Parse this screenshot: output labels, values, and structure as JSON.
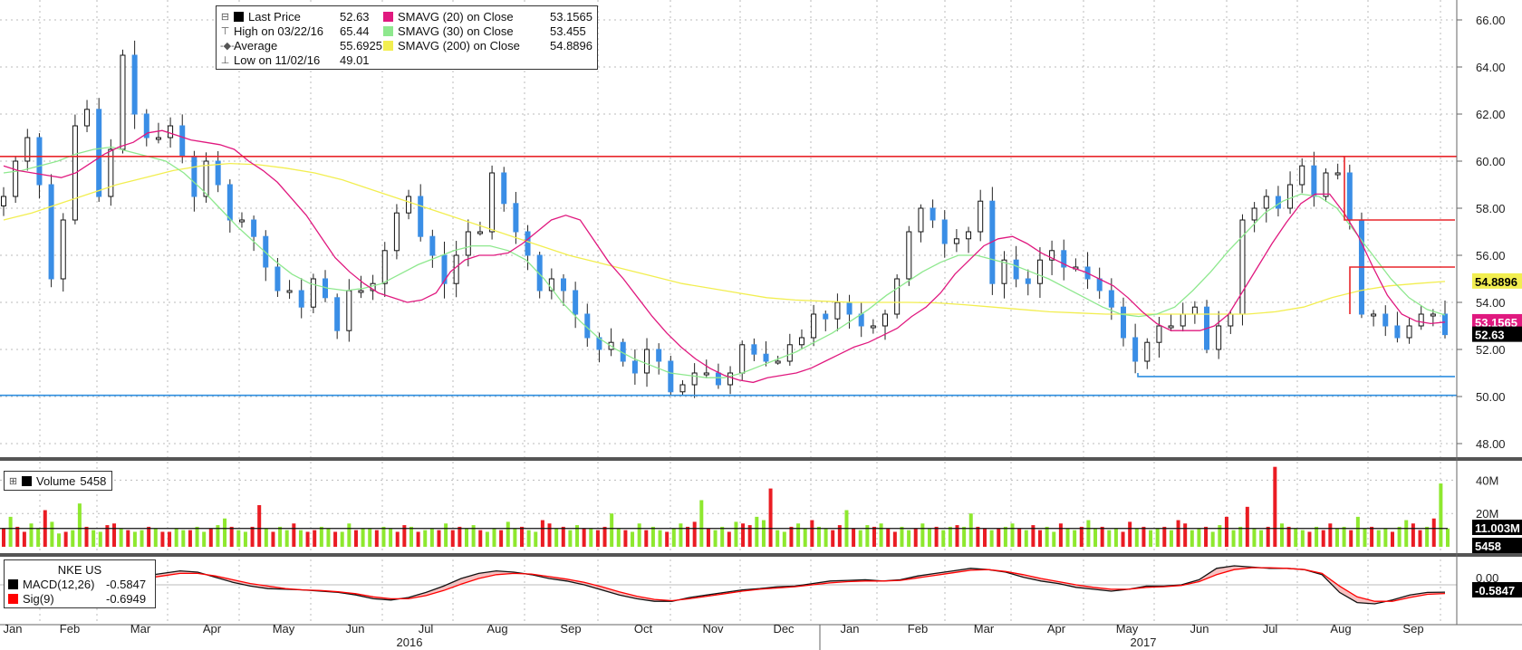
{
  "chart_data": [
    {
      "type": "candlestick",
      "ticker": "NKE US",
      "y_ticks": [
        "48.00",
        "50.00",
        "52.00",
        "54.00",
        "56.00",
        "58.00",
        "60.00",
        "62.00",
        "64.00",
        "66.00"
      ],
      "ylim": [
        47,
        67
      ],
      "x_month_labels": [
        "Jan",
        "Feb",
        "Mar",
        "Apr",
        "May",
        "Jun",
        "Jul",
        "Aug",
        "Sep",
        "Oct",
        "Nov",
        "Dec",
        "Jan",
        "Feb",
        "Mar",
        "Apr",
        "May",
        "Jun",
        "Jul",
        "Aug",
        "Sep"
      ],
      "x_year_labels": [
        "2016",
        "2017"
      ],
      "legend": [
        {
          "label": "Last Price",
          "value": "52.63",
          "color": "#000000"
        },
        {
          "label": "High on 03/22/16",
          "value": "65.44"
        },
        {
          "label": "Average",
          "value": "55.6925"
        },
        {
          "label": "Low on 11/02/16",
          "value": "49.01"
        },
        {
          "label": "SMAVG (20) on Close",
          "value": "53.1565",
          "color": "#e0197f"
        },
        {
          "label": "SMAVG (30) on Close",
          "value": "53.455",
          "color": "#8ee88e"
        },
        {
          "label": "SMAVG (200) on Close",
          "value": "54.8896",
          "color": "#f2ee50"
        }
      ],
      "close_series": [
        58.5,
        60,
        61,
        59,
        55,
        57.5,
        61.5,
        62.2,
        58.5,
        60.5,
        64.5,
        62,
        61,
        61,
        61.5,
        60.2,
        58.5,
        60,
        59,
        57.5,
        57.5,
        56.8,
        55.5,
        54.5,
        54.5,
        53.8,
        55,
        54.2,
        52.8,
        54.5,
        54.5,
        54.8,
        56.2,
        57.8,
        58.5,
        56.8,
        56,
        54.8,
        56,
        57,
        57,
        59.5,
        58.2,
        57,
        56,
        54.5,
        55,
        54.5,
        53.5,
        52.5,
        52,
        52.3,
        51.5,
        51,
        52,
        51.5,
        50.2,
        50.5,
        51,
        51,
        50.5,
        51,
        52.2,
        51.8,
        51.5,
        51.5,
        52.2,
        52.5,
        53.5,
        53.3,
        54,
        53.5,
        53,
        53,
        53.5,
        55,
        57,
        58,
        57.5,
        56.5,
        56.7,
        57,
        58.3,
        54.8,
        55.8,
        55,
        54.8,
        55.8,
        56.2,
        55.5,
        55.5,
        55,
        54.5,
        53.8,
        52.5,
        51.5,
        52.3,
        53,
        53,
        53.5,
        53.8,
        52,
        53,
        53.5,
        57.5,
        58,
        58.5,
        58,
        59,
        59.8,
        58.5,
        59.5,
        59.5,
        57.5,
        53.5,
        53.5,
        53,
        52.5,
        53,
        53.5,
        53.5,
        52.63
      ],
      "sma20": [
        59.8,
        59.6,
        59.5,
        59.4,
        59.3,
        59.5,
        59.9,
        60.3,
        60.6,
        60.8,
        61.2,
        61.3,
        61.1,
        60.9,
        60.8,
        60.7,
        60.5,
        60,
        59.6,
        59.1,
        58.4,
        57.7,
        56.8,
        55.9,
        55.3,
        54.8,
        54.4,
        54.2,
        54,
        54.1,
        54.4,
        55.3,
        55.8,
        56,
        56,
        56.1,
        56.5,
        57,
        57.5,
        57.7,
        57.5,
        56.6,
        55.7,
        55,
        54.2,
        53.4,
        52.7,
        52.1,
        51.6,
        51.2,
        50.9,
        50.7,
        50.6,
        50.8,
        50.9,
        51,
        51.2,
        51.5,
        51.8,
        52.1,
        52.3,
        52.6,
        52.9,
        53.4,
        53.8,
        54.4,
        55.2,
        55.8,
        56.4,
        56.7,
        56.8,
        56.5,
        56.1,
        55.8,
        55.5,
        55.3,
        55,
        54.7,
        54.2,
        53.6,
        53.1,
        52.8,
        52.8,
        52.8,
        53,
        53.5,
        54.5,
        55.5,
        56.5,
        57.4,
        58.2,
        58.6,
        58.6,
        57.8,
        56.8,
        55.5,
        54.3,
        53.5,
        53.2,
        53.1,
        53.16
      ],
      "sma30": [
        59.5,
        59.6,
        59.8,
        60,
        60.3,
        60.5,
        60.6,
        60.4,
        60.2,
        60,
        59.5,
        58.8,
        58,
        57.2,
        56.5,
        55.8,
        55.2,
        54.8,
        54.6,
        54.5,
        54.6,
        54.8,
        55.2,
        55.6,
        55.9,
        56.2,
        56.4,
        56.4,
        56.2,
        55.8,
        55,
        54,
        53.2,
        52.5,
        52,
        51.6,
        51.3,
        51,
        50.9,
        50.8,
        50.8,
        51,
        51.3,
        51.6,
        51.9,
        52.3,
        52.7,
        53.2,
        53.7,
        54.3,
        54.8,
        55.3,
        55.7,
        56,
        56,
        55.8,
        55.6,
        55.3,
        55,
        54.6,
        54.2,
        53.8,
        53.5,
        53.4,
        53.5,
        53.8,
        54.5,
        55.3,
        56.2,
        57,
        57.8,
        58.3,
        58.6,
        58.5,
        58,
        57,
        56,
        55,
        54.2,
        53.7,
        53.46
      ],
      "sma200": [
        57.5,
        57.8,
        58.2,
        58.6,
        59,
        59.3,
        59.6,
        59.8,
        59.9,
        59.85,
        59.7,
        59.5,
        59.2,
        58.8,
        58.4,
        58,
        57.6,
        57.2,
        56.8,
        56.4,
        56,
        55.7,
        55.4,
        55.1,
        54.8,
        54.6,
        54.4,
        54.2,
        54.1,
        54.05,
        54,
        54,
        54,
        53.98,
        53.9,
        53.8,
        53.7,
        53.6,
        53.55,
        53.5,
        53.5,
        53.5,
        53.5,
        53.5,
        53.5,
        53.6,
        53.8,
        54.2,
        54.5,
        54.7,
        54.8,
        54.89
      ],
      "resistance_levels": [
        60.2,
        57.5,
        55.5
      ],
      "support_levels": [
        50.05,
        50.85
      ],
      "axis_tags": [
        {
          "text": "54.8896",
          "value": 54.8896,
          "bg": "#f2ee50",
          "fg": "#000000"
        },
        {
          "text": "53.1565",
          "value": 53.1565,
          "bg": "#e0197f",
          "fg": "#ffffff"
        },
        {
          "text": "52.63",
          "value": 52.63,
          "bg": "#000000",
          "fg": "#ffffff"
        }
      ]
    },
    {
      "type": "bar",
      "title": "Volume",
      "value": "5458",
      "y_ticks": [
        "20M",
        "40M"
      ],
      "tags": [
        {
          "text": "11.003M",
          "bg": "#000000",
          "fg": "#ffffff"
        },
        {
          "text": "5458",
          "bg": "#000000",
          "fg": "#ffffff"
        }
      ],
      "volume_average": 11.003,
      "volume_m": [
        11,
        18,
        12,
        9,
        14,
        11,
        22,
        15,
        8,
        9,
        10,
        26,
        12,
        10,
        9,
        13,
        14,
        11,
        10,
        9,
        10,
        12,
        11,
        9,
        9,
        11,
        10,
        10,
        12,
        9,
        11,
        13,
        17,
        12,
        10,
        9,
        12,
        25,
        11,
        9,
        12,
        10,
        14,
        10,
        9,
        10,
        12,
        11,
        9,
        9,
        14,
        10,
        11,
        11,
        10,
        12,
        11,
        9,
        13,
        12,
        9,
        10,
        11,
        10,
        14,
        10,
        12,
        11,
        13,
        10,
        9,
        11,
        10,
        15,
        11,
        12,
        10,
        9,
        16,
        14,
        11,
        12,
        10,
        13,
        11,
        11,
        10,
        12,
        20,
        11,
        10,
        9,
        14,
        10,
        12,
        10,
        9,
        11,
        14,
        12,
        15,
        28,
        11,
        10,
        12,
        9,
        15,
        14,
        13,
        18,
        16,
        35,
        10,
        9,
        12,
        14,
        11,
        16,
        12,
        11,
        10,
        13,
        22,
        11,
        10,
        13,
        12,
        14,
        11,
        9,
        12,
        10,
        11,
        14,
        11,
        12,
        10,
        12,
        13,
        12,
        20,
        12,
        11,
        10,
        11,
        12,
        14,
        11,
        10,
        13,
        10,
        12,
        9,
        14,
        11,
        10,
        12,
        16,
        11,
        12,
        10,
        11,
        9,
        15,
        11,
        12,
        10,
        11,
        12,
        10,
        16,
        14,
        10,
        11,
        12,
        9,
        13,
        18,
        10,
        12,
        24,
        11,
        10,
        12,
        48,
        14,
        12,
        11,
        10,
        9,
        12,
        10,
        14,
        11,
        12,
        10,
        18,
        11,
        12,
        10,
        11,
        9,
        12,
        16,
        14,
        10,
        12,
        17,
        38,
        11
      ]
    },
    {
      "type": "line",
      "title": "NKE US",
      "series": [
        {
          "name": "MACD(12,26)",
          "value": "-0.5847",
          "color": "#000000"
        },
        {
          "name": "Sig(9)",
          "value": "-0.6949",
          "color": "#ff0000"
        }
      ],
      "y_ticks": [
        "0.00"
      ],
      "tag": {
        "text": "-0.5847",
        "bg": "#000000",
        "fg": "#ffffff"
      },
      "macd": [
        0.7,
        0.9,
        1.1,
        1,
        0.6,
        0.2,
        -0.1,
        -0.3,
        -0.35,
        -0.4,
        -0.5,
        -0.6,
        -0.8,
        -1.1,
        -1.2,
        -1,
        -0.6,
        -0.1,
        0.5,
        0.9,
        1.1,
        1,
        0.8,
        0.5,
        0.3,
        0,
        -0.4,
        -0.8,
        -1.1,
        -1.3,
        -1.3,
        -1,
        -0.8,
        -0.6,
        -0.4,
        -0.3,
        -0.15,
        -0.1,
        0.1,
        0.3,
        0.35,
        0.4,
        0.3,
        0.4,
        0.7,
        0.9,
        1.1,
        1.3,
        1.2,
        1,
        0.6,
        0.3,
        0.1,
        -0.2,
        -0.35,
        -0.5,
        -0.35,
        -0.1,
        -0.1,
        0,
        0.4,
        1.3,
        1.5,
        1.4,
        1.3,
        1.3,
        1.2,
        0.8,
        -0.6,
        -1.4,
        -1.5,
        -1.2,
        -0.8,
        -0.6,
        -0.58
      ],
      "signal": [
        0.5,
        0.7,
        0.9,
        0.9,
        0.7,
        0.4,
        0.1,
        -0.1,
        -0.3,
        -0.4,
        -0.45,
        -0.55,
        -0.7,
        -0.95,
        -1.1,
        -1.1,
        -0.85,
        -0.45,
        0.05,
        0.5,
        0.8,
        0.9,
        0.85,
        0.65,
        0.45,
        0.2,
        -0.15,
        -0.55,
        -0.9,
        -1.15,
        -1.25,
        -1.1,
        -0.9,
        -0.7,
        -0.5,
        -0.35,
        -0.25,
        -0.15,
        0,
        0.15,
        0.25,
        0.3,
        0.3,
        0.35,
        0.55,
        0.75,
        0.95,
        1.15,
        1.2,
        1.05,
        0.8,
        0.5,
        0.25,
        0,
        -0.2,
        -0.35,
        -0.35,
        -0.2,
        -0.15,
        -0.05,
        0.25,
        0.8,
        1.2,
        1.35,
        1.35,
        1.3,
        1.2,
        0.9,
        -0.1,
        -0.95,
        -1.3,
        -1.3,
        -1,
        -0.75,
        -0.69
      ]
    }
  ]
}
